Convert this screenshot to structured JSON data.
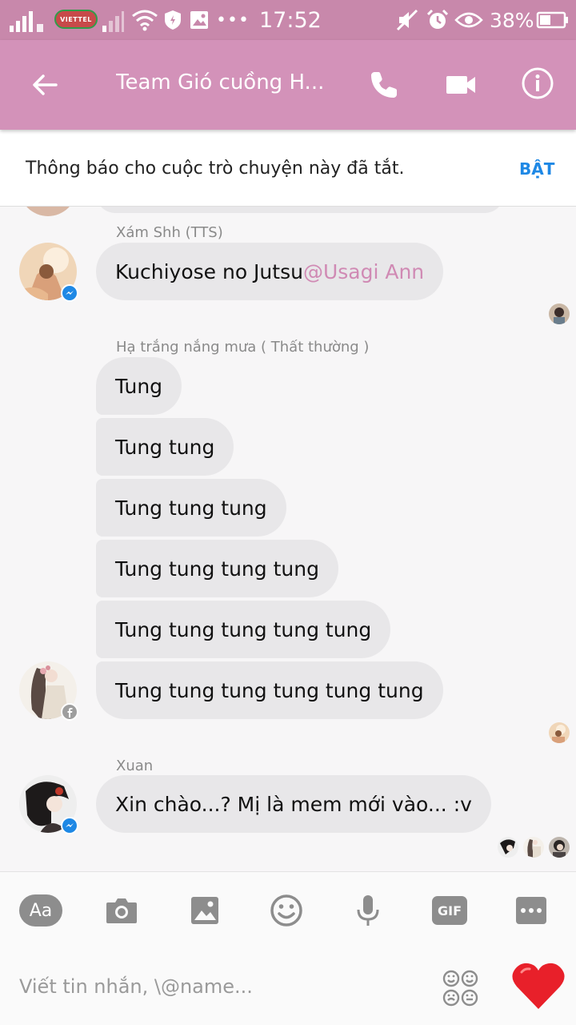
{
  "status_bar": {
    "carrier": "VIETTEL",
    "time": "17:52",
    "battery_percent": "38%"
  },
  "header": {
    "title": "Team Gió cuồng H..."
  },
  "notification": {
    "text": "Thông báo cho cuộc trò chuyện này đã tắt.",
    "action_label": "BẬT"
  },
  "messages": {
    "group1": {
      "sender": "Xám Shh (TTS)",
      "text": "Kuchiyose no Jutsu ",
      "mention": "@Usagi Ann"
    },
    "group2": {
      "sender": "Hạ trắng nắng mưa ( Thất thường )",
      "texts": [
        "Tung",
        "Tung tung",
        "Tung tung tung",
        "Tung tung tung tung",
        "Tung tung tung tung tung",
        "Tung tung tung tung tung tung"
      ]
    },
    "group3": {
      "sender": "Xuan",
      "text": "Xin chào...? Mị là mem mới vào... :v"
    }
  },
  "toolbar": {
    "text_button_label": "Aa",
    "gif_label": "GIF"
  },
  "composer": {
    "placeholder": "Viết tin nhắn, \\@name..."
  },
  "colors": {
    "status_bar": "#c888ab",
    "header": "#d392b9",
    "bubble": "#e8e7e9",
    "mention": "#d08ab4",
    "action": "#1e88e5",
    "heart": "#e8202a",
    "icon_gray": "#8d8d8d"
  }
}
